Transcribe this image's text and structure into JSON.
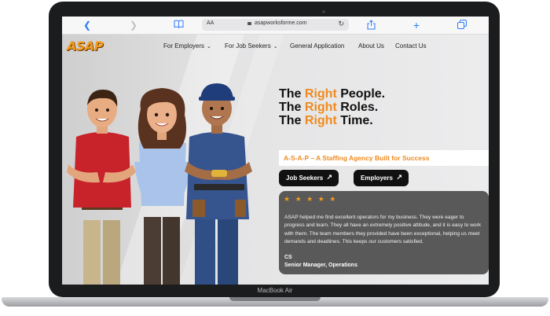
{
  "device": {
    "label": "MacBook Air"
  },
  "browser": {
    "url_text": "asapworksforme.com",
    "text_size_label": "AA"
  },
  "site": {
    "logo": "ASAP",
    "nav": {
      "employers": "For Employers",
      "job_seekers": "For Job Seekers",
      "general_application": "General Application",
      "about_us": "About Us",
      "contact_us": "Contact Us"
    },
    "headline": [
      {
        "pre": "The ",
        "highlight": "Right",
        "post": " People."
      },
      {
        "pre": "The ",
        "highlight": "Right",
        "post": " Roles."
      },
      {
        "pre": "The ",
        "highlight": "Right",
        "post": " Time."
      }
    ],
    "tagline": "A-S-A-P – A Staffing Agency Built for Success",
    "buttons": {
      "job_seekers": "Job Seekers",
      "employers": "Employers"
    },
    "testimonial": {
      "stars": "★ ★ ★ ★ ★",
      "rating": 5,
      "quote": "ASAP helped me find excellent operators for my business. They were eager to progress and learn. They all have an extremely positive attitude, and it is easy to work with them. The team members they provided have been exceptional, helping us meet demands and deadlines. This keeps our customers satisfied.",
      "author": "CS",
      "role": "Senior Manager, Operations"
    },
    "carousel": {
      "active_index": 0,
      "count": 2
    }
  },
  "colors": {
    "accent": "#ef8a1f",
    "button_bg": "#111111",
    "testimonial_bg": "#595959",
    "browser_blue": "#2d7cf6"
  }
}
